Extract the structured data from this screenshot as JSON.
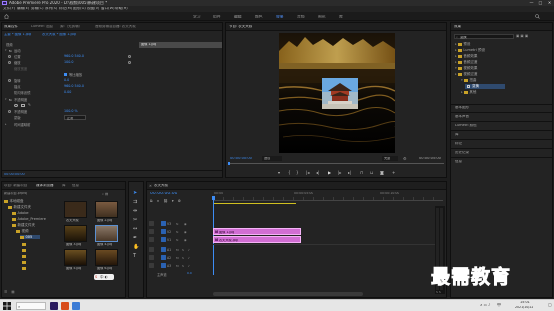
{
  "window": {
    "title": "Adobe Premiere Pro 2020 - D:\\视频\\005\\新建项目 *",
    "minimize": "—",
    "maximize": "□",
    "close": "✕"
  },
  "menu": [
    "文件(F)",
    "编辑(E)",
    "剪辑(C)",
    "序列(S)",
    "标记(M)",
    "图形(G)",
    "视图(V)",
    "窗口(W)",
    "帮助(H)"
  ],
  "workspaces": [
    {
      "label": "学习",
      "active": false
    },
    {
      "label": "组件",
      "active": false
    },
    {
      "label": "编辑",
      "active": false
    },
    {
      "label": "颜色",
      "active": false
    },
    {
      "label": "效果",
      "active": true
    },
    {
      "label": "音频",
      "active": false
    },
    {
      "label": "图形",
      "active": false
    },
    {
      "label": "库",
      "active": false
    }
  ],
  "source_panel": {
    "tabs": [
      "效果控件",
      "Lumetri 范围",
      "源:（无剪辑）",
      "音频剪辑混合器: 农夫大叔"
    ],
    "header_source": "主要 * 图像 1.jpg",
    "header_seq": "农夫大叔 * 图像 1.jpg",
    "clip_label": "图像 1.jpg",
    "sections": {
      "video": "视频",
      "motion": "运动",
      "opacity": "不透明度",
      "time_remap": "时间重映射",
      "transform": "变换",
      "offset_label": "偏移",
      "mask": "蒙版"
    },
    "properties": [
      {
        "label": "位置",
        "value": "960.0   540.0"
      },
      {
        "label": "缩放",
        "value": "100.0"
      },
      {
        "label": "缩放宽度",
        "value": ""
      },
      {
        "label": "等比缩放",
        "value": ""
      },
      {
        "label": "旋转",
        "value": "0.0"
      },
      {
        "label": "锚点",
        "value": "960.0   540.0"
      },
      {
        "label": "防闪烁滤镜",
        "value": "0.00"
      }
    ],
    "opacity_value": "100.0 %",
    "blend_mode": "正常",
    "footer_time": "00:00:00:00"
  },
  "program": {
    "title": "节目: 农夫大叔",
    "timecode_left": "00:00:00:00",
    "fit": "适合",
    "quality": "完整",
    "timecode_right": "00:00:05:00"
  },
  "effects_panel": {
    "title": "效果",
    "search_value": "变换",
    "tree": [
      {
        "label": "预设",
        "indent": 0
      },
      {
        "label": "Lumetri 预设",
        "indent": 0
      },
      {
        "label": "音频效果",
        "indent": 0
      },
      {
        "label": "音频过渡",
        "indent": 0
      },
      {
        "label": "视频效果",
        "indent": 0
      },
      {
        "label": "视频过渡",
        "indent": 0
      },
      {
        "label": "扭曲",
        "indent": 1
      },
      {
        "label": "变换",
        "indent": 2,
        "selected": true
      },
      {
        "label": "其他",
        "indent": 1
      }
    ],
    "sections": [
      "基本图形",
      "基本声音",
      "Lumetri 颜色",
      "库",
      "标记",
      "历史记录",
      "信息"
    ]
  },
  "project_panel": {
    "tabs": [
      "项目: 新建项目",
      "媒体浏览器",
      "库",
      "信息"
    ],
    "path": "新建项目.prproj",
    "items": [
      {
        "label": "农夫大叔",
        "color": "#3a2a1a"
      },
      {
        "label": "图像 2.jpg",
        "color": "#5a4030"
      },
      {
        "label": "图像 3.jpg",
        "color": "#2e2212"
      },
      {
        "label": "图像 4.jpg",
        "color": "#6a5848"
      },
      {
        "label": "图像 5.jpg",
        "color": "#3e2c16"
      },
      {
        "label": "图像 6.jpg",
        "color": "#402812"
      }
    ],
    "folders": [
      "本地磁盘",
      "新建文件夹",
      "Adobe",
      "Adobe_Premiere",
      "新建文件夹",
      "视频",
      "005"
    ]
  },
  "timeline": {
    "title": "农夫大叔",
    "timecode": "00:00:00:00",
    "ruler": [
      "00:00",
      "00:00:05:00",
      "00:00:10:00"
    ],
    "tracks": [
      {
        "name": "V3",
        "type": "video"
      },
      {
        "name": "V2",
        "type": "video"
      },
      {
        "name": "V1",
        "type": "video"
      },
      {
        "name": "A1",
        "type": "audio"
      },
      {
        "name": "A2",
        "type": "audio"
      },
      {
        "name": "A3",
        "type": "audio"
      },
      {
        "name": "主声道",
        "type": "master",
        "value": "0.0"
      }
    ],
    "clips": [
      {
        "track": "V2",
        "label": "图像 1.jpg",
        "fx": "fx"
      },
      {
        "track": "V1",
        "label": "农夫大叔.jpg",
        "fx": "fx"
      }
    ]
  },
  "taskbar": {
    "time": "15:01",
    "date": "2021/10/22",
    "lang": "中"
  },
  "watermark": "最需教育"
}
